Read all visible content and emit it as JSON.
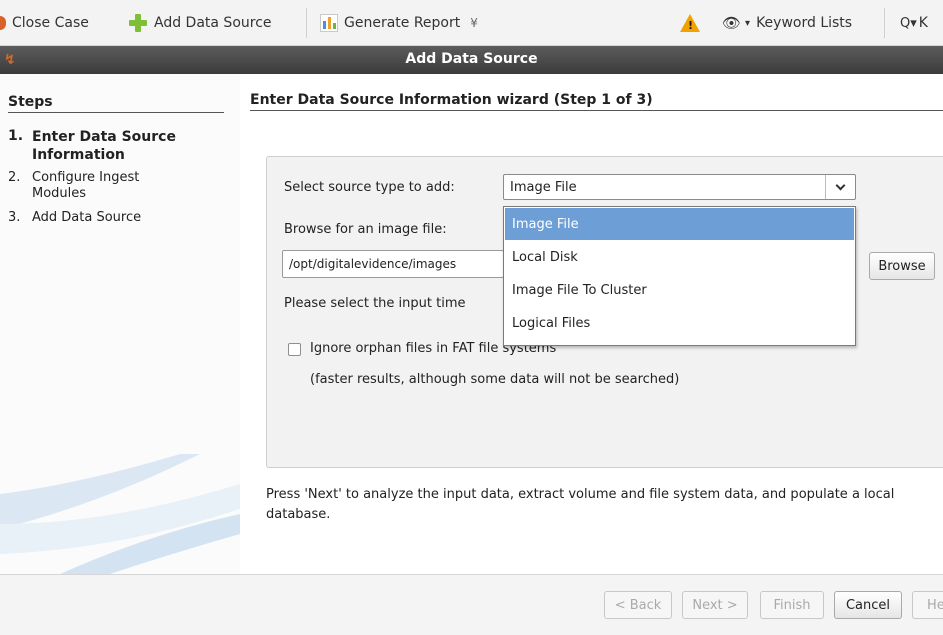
{
  "toolbar": {
    "close_case": "Close Case",
    "add_data_source": "Add Data Source",
    "generate_report": "Generate Report",
    "generate_report_arrow": "¥",
    "keyword_lists": "Keyword Lists",
    "keyword_search_partial": "K"
  },
  "dialog": {
    "title": "Add Data Source"
  },
  "steps": {
    "heading": "Steps",
    "items": [
      {
        "num": "1.",
        "label": "Enter Data Source Information"
      },
      {
        "num": "2.",
        "label": "Configure Ingest Modules"
      },
      {
        "num": "3.",
        "label": "Add Data Source"
      }
    ]
  },
  "wizard": {
    "heading": "Enter Data Source Information wizard (Step 1 of 3)",
    "source_type_label": "Select source type to add:",
    "source_type_value": "Image File",
    "browse_label": "Browse for an image file:",
    "path_value": "/opt/digitalevidence/images",
    "browse_button": "Browse",
    "timezone_label": "Please select the input time",
    "orphan_label": "Ignore orphan files in FAT file systems",
    "orphan_hint": "(faster results, although some data will not be searched)",
    "dropdown_options": [
      "Image File",
      "Local Disk",
      "Image File To Cluster",
      "Logical Files"
    ],
    "next_hint": "Press 'Next' to analyze the input data, extract volume and file system data, and populate a local database."
  },
  "footer": {
    "back": "< Back",
    "next": "Next >",
    "finish": "Finish",
    "cancel": "Cancel",
    "help_partial": "He"
  }
}
